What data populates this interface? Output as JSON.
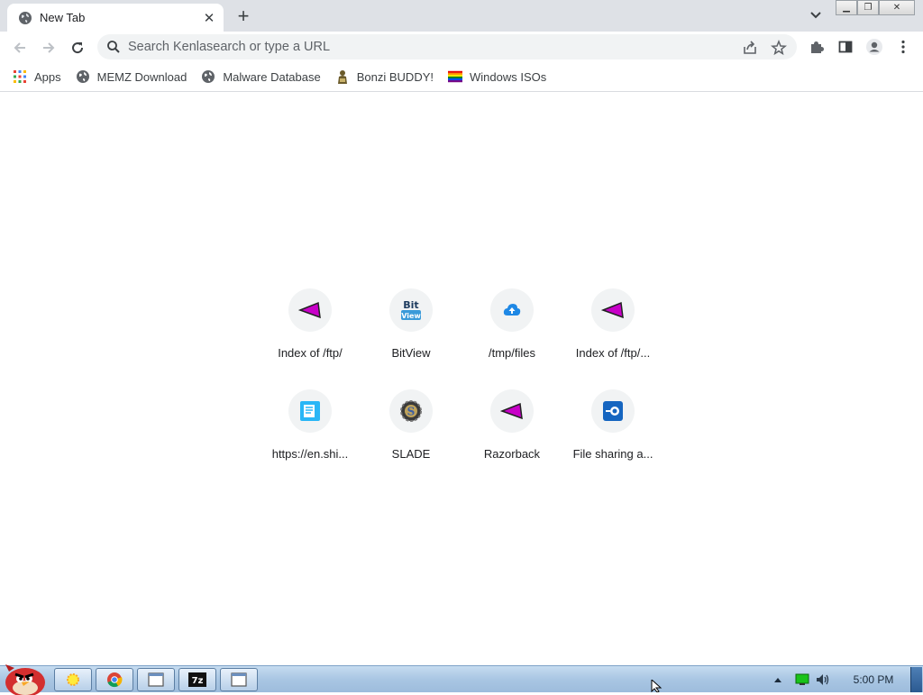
{
  "tab": {
    "title": "New Tab"
  },
  "omnibox": {
    "placeholder": "Search Kenlasearch or type a URL"
  },
  "bookmarks": [
    {
      "label": "Apps",
      "icon": "apps-grid-icon"
    },
    {
      "label": "MEMZ Download",
      "icon": "globe-icon"
    },
    {
      "label": "Malware Database",
      "icon": "globe-icon"
    },
    {
      "label": "Bonzi BUDDY!",
      "icon": "bonzi-icon"
    },
    {
      "label": "Windows ISOs",
      "icon": "rainbow-flag-icon"
    }
  ],
  "shortcuts": [
    {
      "label": "Index of /ftp/",
      "icon": "magenta-wedge-icon"
    },
    {
      "label": "BitView",
      "icon": "bitview-icon"
    },
    {
      "label": "/tmp/files",
      "icon": "cloud-upload-icon"
    },
    {
      "label": "Index of /ftp/...",
      "icon": "magenta-wedge-icon"
    },
    {
      "label": "https://en.shi...",
      "icon": "document-icon"
    },
    {
      "label": "SLADE",
      "icon": "slade-gear-icon"
    },
    {
      "label": "Razorback",
      "icon": "magenta-wedge-icon"
    },
    {
      "label": "File sharing a...",
      "icon": "file-sharing-icon"
    }
  ],
  "taskbar": {
    "clock": "5:00 PM",
    "buttons": [
      "explorer",
      "chrome",
      "window",
      "7zip",
      "window"
    ]
  },
  "colors": {
    "tabstrip": "#dee1e6",
    "accent": "#1a73e8",
    "taskbar": "#a9c6e3"
  }
}
